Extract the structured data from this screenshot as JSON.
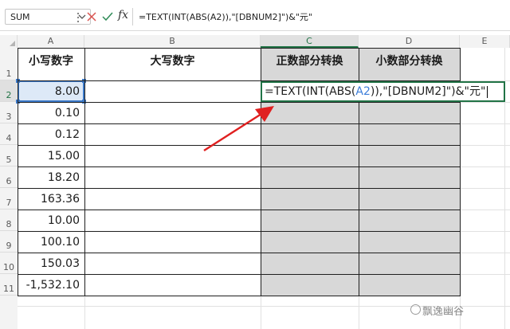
{
  "formula_bar": {
    "name_box": "SUM",
    "formula": "=TEXT(INT(ABS(A2)),\"[DBNUM2]\")&\"元\"",
    "fx_label": "fx"
  },
  "columns": [
    "A",
    "B",
    "C",
    "D",
    "E"
  ],
  "rows": [
    "1",
    "2",
    "3",
    "4",
    "5",
    "6",
    "7",
    "8",
    "9",
    "10",
    "11"
  ],
  "headers": {
    "a": "小写数字",
    "b": "大写数字",
    "c": "正数部分转换",
    "d": "小数部分转换"
  },
  "values": [
    "8.00",
    "0.10",
    "0.12",
    "15.00",
    "18.20",
    "163.36",
    "10.00",
    "100.10",
    "150.03",
    "-1,532.10"
  ],
  "editing": {
    "part1": "=TEXT(INT(ABS(",
    "ref": "A2",
    "part2": ")),\"[DBNUM2]\")&\"元\""
  },
  "watermark": "飘逸幽谷",
  "colors": {
    "accent_green": "#217346",
    "selection_blue": "#3b79c9",
    "arrow_red": "#e02020",
    "gray_fill": "#d8d8d8"
  }
}
